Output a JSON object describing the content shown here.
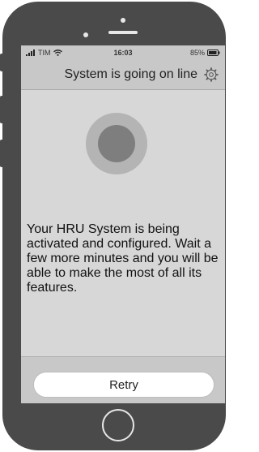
{
  "status_bar": {
    "carrier": "TIM",
    "time": "16:03",
    "battery": "85%",
    "icons": [
      "signal-bars-icon",
      "wifi-icon",
      "battery-icon"
    ]
  },
  "header": {
    "title": "System is going on line",
    "icon": "gear-icon"
  },
  "main": {
    "indicator_icon": "connection-pulse-icon",
    "message": "Your HRU System is being activated and configured. Wait a few more minutes and you will be able to make the most of all its features."
  },
  "footer": {
    "retry_label": "Retry"
  },
  "colors": {
    "screen_bg": "#d7d7d7",
    "bar_bg": "#c8c8c8",
    "phone_body": "#4a4a4a",
    "indicator_outer": "#b4b4b4",
    "indicator_inner": "#7e7e7e"
  }
}
